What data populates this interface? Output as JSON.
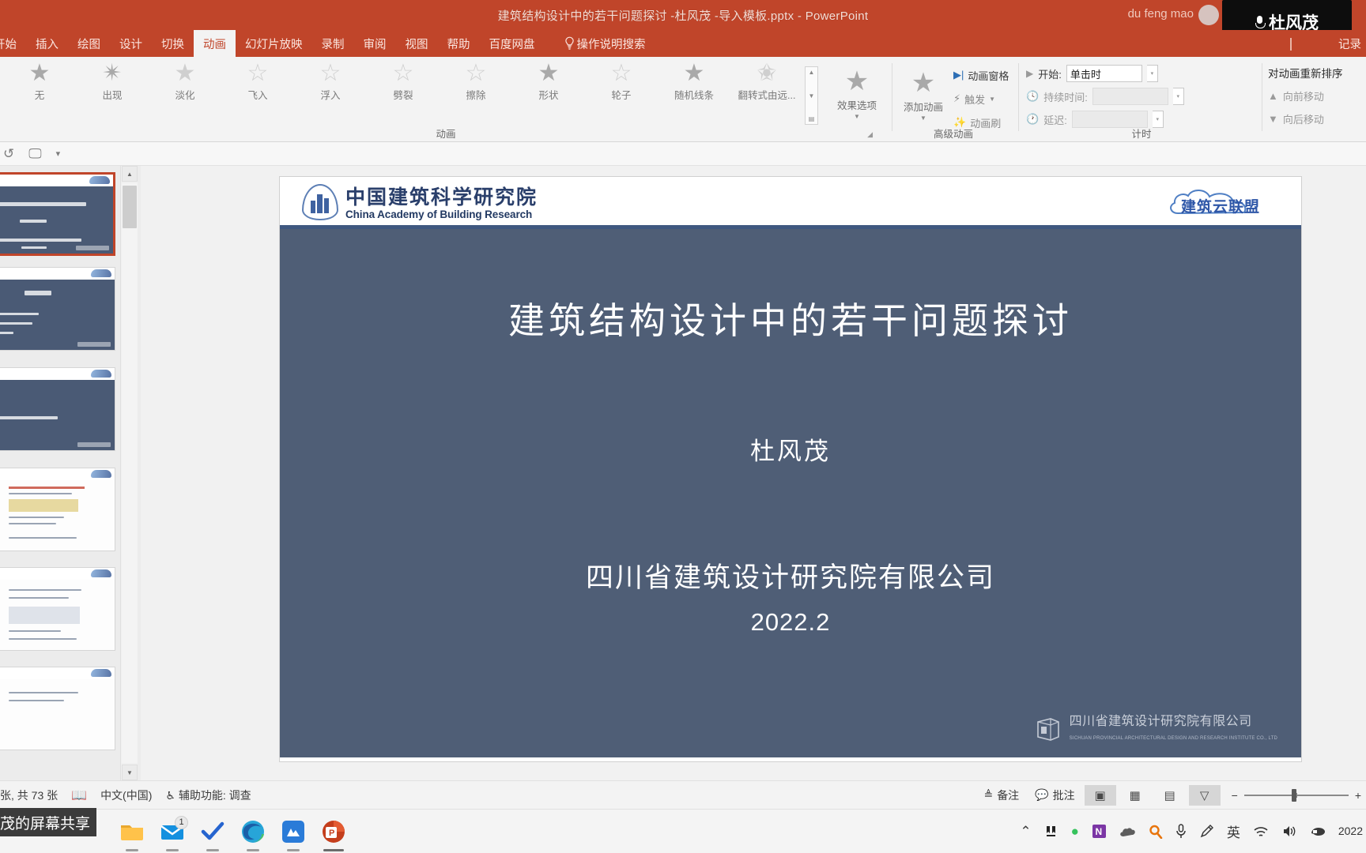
{
  "titlebar": {
    "document_title": "建筑结构设计中的若干问题探讨 -杜风茂 -导入模板.pptx",
    "separator": "-",
    "app_name": "PowerPoint",
    "user_name": "du feng mao",
    "speaker_chip_name": "杜风茂"
  },
  "ribbon": {
    "tabs": [
      {
        "label": "开始",
        "active": false
      },
      {
        "label": "插入",
        "active": false
      },
      {
        "label": "绘图",
        "active": false
      },
      {
        "label": "设计",
        "active": false
      },
      {
        "label": "切换",
        "active": false
      },
      {
        "label": "动画",
        "active": true
      },
      {
        "label": "幻灯片放映",
        "active": false
      },
      {
        "label": "录制",
        "active": false
      },
      {
        "label": "审阅",
        "active": false
      },
      {
        "label": "视图",
        "active": false
      },
      {
        "label": "帮助",
        "active": false
      },
      {
        "label": "百度网盘",
        "active": false
      }
    ],
    "tell_me": "操作说明搜索",
    "tell_me_icon": "lightbulb-icon",
    "right_label": "记录",
    "groups": {
      "animation": "动画",
      "advanced_animation": "高级动画",
      "timing": "计时"
    },
    "gallery": [
      {
        "label": "无",
        "icon": "star-none-icon"
      },
      {
        "label": "出现",
        "icon": "star-appear-icon"
      },
      {
        "label": "淡化",
        "icon": "star-fade-icon"
      },
      {
        "label": "飞入",
        "icon": "star-flyin-icon"
      },
      {
        "label": "浮入",
        "icon": "star-floatin-icon"
      },
      {
        "label": "劈裂",
        "icon": "star-split-icon"
      },
      {
        "label": "擦除",
        "icon": "star-wipe-icon"
      },
      {
        "label": "形状",
        "icon": "star-shape-icon"
      },
      {
        "label": "轮子",
        "icon": "star-wheel-icon"
      },
      {
        "label": "随机线条",
        "icon": "star-randombars-icon"
      },
      {
        "label": "翻转式由远...",
        "icon": "star-grow-turn-icon"
      }
    ],
    "effect_options": "效果选项",
    "add_animation": "添加动画",
    "animation_pane": "动画窗格",
    "trigger": "触发",
    "animation_painter": "动画刷",
    "start_label": "开始:",
    "start_value": "单击时",
    "duration_label": "持续时间:",
    "duration_value": "",
    "delay_label": "延迟:",
    "delay_value": "",
    "reorder_title": "对动画重新排序",
    "move_earlier": "向前移动",
    "move_later": "向后移动"
  },
  "quick_access": {
    "items": [
      {
        "name": "replay-icon",
        "glyph": "↺"
      },
      {
        "name": "preview-animation-icon",
        "glyph": "🖵"
      },
      {
        "name": "customize-qat-caret-icon",
        "glyph": "▾"
      }
    ]
  },
  "thumbnails": [
    {
      "index": 1,
      "selected": true,
      "kind": "title"
    },
    {
      "index": 2,
      "selected": false,
      "kind": "contents"
    },
    {
      "index": 3,
      "selected": false,
      "kind": "section"
    },
    {
      "index": 4,
      "selected": false,
      "kind": "white-doc"
    },
    {
      "index": 5,
      "selected": false,
      "kind": "white-doc2"
    },
    {
      "index": 6,
      "selected": false,
      "kind": "white-plain"
    }
  ],
  "slide": {
    "header_logo_cn": "中国建筑科学研究院",
    "header_logo_en": "China Academy of Building Research",
    "header_cloud_logo": "建筑云联盟",
    "title": "建筑结构设计中的若干问题探讨",
    "author": "杜风茂",
    "organization": "四川省建筑设计研究院有限公司",
    "date": "2022.2",
    "footer_logo_cn": "四川省建筑设计研究院有限公司",
    "footer_logo_en": "SICHUAN PROVINCIAL ARCHITECTURAL DESIGN AND RESEARCH INSTITUTE CO., LTD"
  },
  "statusbar": {
    "slide_count": "张, 共 73 张",
    "language": "中文(中国)",
    "accessibility": "辅助功能: 调查",
    "notes": "备注",
    "comments": "批注",
    "views": [
      {
        "name": "normal-view",
        "glyph": "▣",
        "selected": true
      },
      {
        "name": "slide-sorter-view",
        "glyph": "▦",
        "selected": false
      },
      {
        "name": "reading-view",
        "glyph": "▤",
        "selected": false
      },
      {
        "name": "slideshow-view",
        "glyph": "▽",
        "selected": true
      }
    ],
    "zoom_out": "−",
    "zoom_in": "+"
  },
  "taskbar": {
    "share_label": "茂的屏幕共享",
    "apps": [
      {
        "name": "file-explorer-icon",
        "badge": ""
      },
      {
        "name": "mail-icon",
        "badge": "1"
      },
      {
        "name": "todo-icon",
        "badge": ""
      },
      {
        "name": "edge-browser-icon",
        "badge": ""
      },
      {
        "name": "blue-app-icon",
        "badge": ""
      },
      {
        "name": "powerpoint-icon",
        "badge": ""
      }
    ],
    "tray": [
      {
        "name": "show-hidden-icons-chevron",
        "glyph": "⌃"
      },
      {
        "name": "tray-app-icon",
        "glyph": "⛉"
      },
      {
        "name": "green-dot-icon",
        "glyph": "●"
      },
      {
        "name": "onenote-icon",
        "glyph": "N"
      },
      {
        "name": "onedrive-icon",
        "glyph": "☁"
      },
      {
        "name": "search-icon",
        "glyph": "🔎"
      },
      {
        "name": "microphone-icon",
        "glyph": "🎤"
      },
      {
        "name": "pen-icon",
        "glyph": "✎"
      },
      {
        "name": "ime-english-icon",
        "glyph": "英"
      },
      {
        "name": "wifi-icon",
        "glyph": "📶"
      },
      {
        "name": "volume-icon",
        "glyph": "🔊"
      },
      {
        "name": "ime-tool-icon",
        "glyph": "⌨"
      }
    ],
    "clock": "2022"
  },
  "colors": {
    "ribbon_accent": "#c0452a",
    "slide_bg": "#4f5e76",
    "slide_rule": "#3f5880",
    "selection": "#c0452a"
  }
}
